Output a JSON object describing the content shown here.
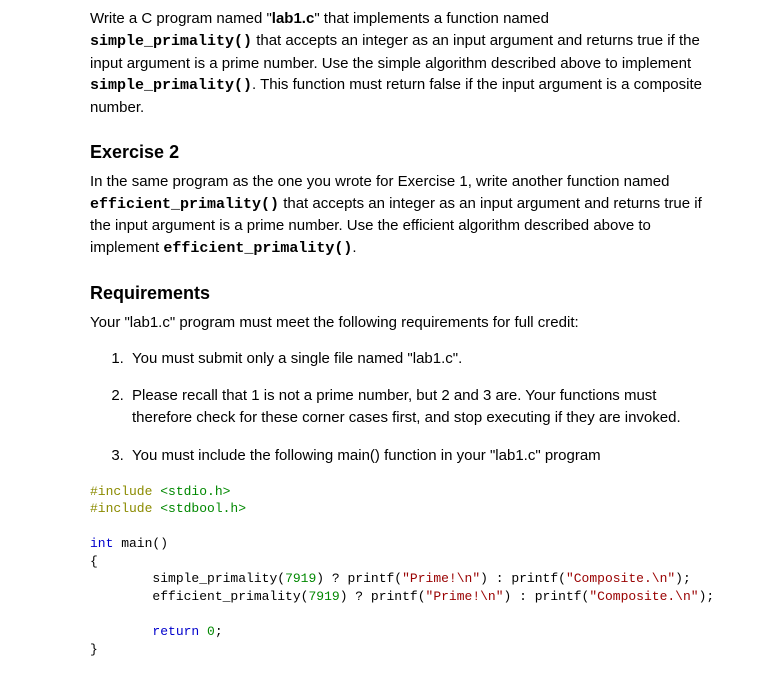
{
  "intro": {
    "p1_a": "Write a C program named \"",
    "p1_file_bold": "lab1.c",
    "p1_b": "\" that implements a function named ",
    "p1_code1": "simple_primality()",
    "p1_c": " that accepts an integer as an input argument and returns true if the input argument is a prime number. Use the simple algorithm described above to implement ",
    "p1_code2": "simple_primality()",
    "p1_d": ". This function must return false if the input argument is a composite number."
  },
  "ex2": {
    "heading": "Exercise 2",
    "p_a": "In the same program as the one you wrote for Exercise 1, write another function named ",
    "p_code1": "efficient_primality()",
    "p_b": " that accepts an integer as an input argument and returns true if the input argument is a prime number. Use the efficient algorithm described above to implement ",
    "p_code2": "efficient_primality()",
    "p_c": "."
  },
  "req": {
    "heading": "Requirements",
    "intro": "Your \"lab1.c\" program must meet the following requirements for full credit:",
    "items": [
      "You must submit only a single file named \"lab1.c\".",
      "Please recall that 1 is not a prime number, but 2 and 3 are. Your functions must therefore check for these corner cases first, and stop executing if they are invoked.",
      "You must include the following main() function in your \"lab1.c\" program"
    ]
  },
  "code": {
    "l1_a": "#include",
    "l1_b": " <stdio.h>",
    "l2_a": "#include",
    "l2_b": " <stdbool.h>",
    "blank1": "",
    "l3_a": "int",
    "l3_b": " main()",
    "l4": "{",
    "indent": "        ",
    "l5_func": "simple_primality",
    "l5_args_a": "(",
    "l5_num": "7919",
    "l5_args_b": ") ? printf(",
    "l5_str1": "\"Prime!\\n\"",
    "l5_mid": ") : printf(",
    "l5_str2": "\"Composite.\\n\"",
    "l5_end": ");",
    "l6_func": "efficient_primality",
    "l6_args_a": "(",
    "l6_num": "7919",
    "l6_args_b": ") ? printf(",
    "l6_str1": "\"Prime!\\n\"",
    "l6_mid": ") : printf(",
    "l6_str2": "\"Composite.\\n\"",
    "l6_end": ");",
    "blank2": "",
    "l7_a": "return",
    "l7_sp": " ",
    "l7_b": "0",
    "l7_c": ";",
    "l8": "}"
  }
}
